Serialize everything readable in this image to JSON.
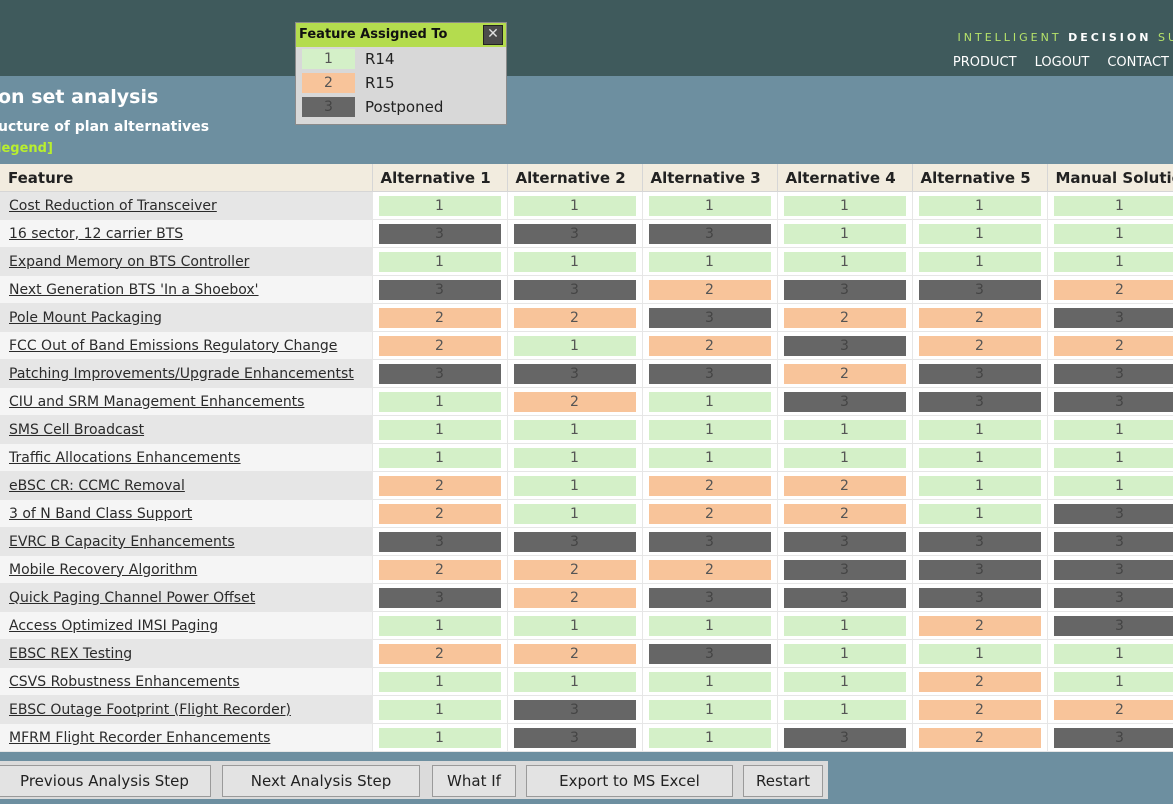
{
  "brand": {
    "part1": "INTELLIGENT ",
    "part2": "DECISION",
    "part3": " SU"
  },
  "nav": [
    "PRODUCT",
    "LOGOUT",
    "CONTACT"
  ],
  "title": "on set analysis",
  "subtitle": "ucture of plan alternatives",
  "legend_link": "legend]",
  "table": {
    "headers": [
      "Feature",
      "Alternative 1",
      "Alternative 2",
      "Alternative 3",
      "Alternative 4",
      "Alternative 5",
      "Manual Solution"
    ],
    "rows": [
      {
        "feature": "Cost Reduction of Transceiver",
        "values": [
          1,
          1,
          1,
          1,
          1,
          1
        ]
      },
      {
        "feature": "16 sector, 12 carrier BTS",
        "values": [
          3,
          3,
          3,
          1,
          1,
          1
        ]
      },
      {
        "feature": "Expand Memory on BTS Controller",
        "values": [
          1,
          1,
          1,
          1,
          1,
          1
        ]
      },
      {
        "feature": "Next Generation BTS 'In a Shoebox'",
        "values": [
          3,
          3,
          2,
          3,
          3,
          2
        ]
      },
      {
        "feature": "Pole Mount Packaging",
        "values": [
          2,
          2,
          3,
          2,
          2,
          3
        ]
      },
      {
        "feature": "FCC Out of Band Emissions Regulatory Change",
        "values": [
          2,
          1,
          2,
          3,
          2,
          2
        ]
      },
      {
        "feature": "Patching Improvements/Upgrade Enhancementst",
        "values": [
          3,
          3,
          3,
          2,
          3,
          3
        ]
      },
      {
        "feature": "CIU and SRM Management Enhancements",
        "values": [
          1,
          2,
          1,
          3,
          3,
          3
        ]
      },
      {
        "feature": "SMS Cell Broadcast",
        "values": [
          1,
          1,
          1,
          1,
          1,
          1
        ]
      },
      {
        "feature": "Traffic Allocations Enhancements",
        "values": [
          1,
          1,
          1,
          1,
          1,
          1
        ]
      },
      {
        "feature": "eBSC CR: CCMC Removal",
        "values": [
          2,
          1,
          2,
          2,
          1,
          1
        ]
      },
      {
        "feature": "3 of N Band Class Support",
        "values": [
          2,
          1,
          2,
          2,
          1,
          3
        ]
      },
      {
        "feature": "EVRC B Capacity Enhancements",
        "values": [
          3,
          3,
          3,
          3,
          3,
          3
        ]
      },
      {
        "feature": "Mobile Recovery Algorithm",
        "values": [
          2,
          2,
          2,
          3,
          3,
          3
        ]
      },
      {
        "feature": "Quick Paging Channel Power Offset",
        "values": [
          3,
          2,
          3,
          3,
          3,
          3
        ]
      },
      {
        "feature": "Access Optimized IMSI Paging",
        "values": [
          1,
          1,
          1,
          1,
          2,
          3
        ]
      },
      {
        "feature": "EBSC REX Testing",
        "values": [
          2,
          2,
          3,
          1,
          1,
          1
        ]
      },
      {
        "feature": "CSVS Robustness Enhancements",
        "values": [
          1,
          1,
          1,
          1,
          2,
          1
        ]
      },
      {
        "feature": "EBSC Outage Footprint (Flight Recorder)",
        "values": [
          1,
          3,
          1,
          1,
          2,
          2
        ]
      },
      {
        "feature": "MFRM Flight Recorder Enhancements",
        "values": [
          1,
          3,
          1,
          3,
          2,
          3
        ]
      }
    ]
  },
  "buttons": [
    "Previous Analysis Step",
    "Next Analysis Step",
    "What If",
    "Export to MS Excel",
    "Restart"
  ],
  "popup": {
    "title": "Feature Assigned To",
    "close_icon": "close-icon",
    "items": [
      {
        "num": "1",
        "label": "R14"
      },
      {
        "num": "2",
        "label": "R15"
      },
      {
        "num": "3",
        "label": "Postponed"
      }
    ]
  },
  "colors": {
    "1": "#d4f0c8",
    "2": "#f8c49a",
    "3": "#666666",
    "header_bar": "#3f5a5c",
    "page_bg": "#6d8fa0",
    "accent_green": "#b4dc4e"
  }
}
